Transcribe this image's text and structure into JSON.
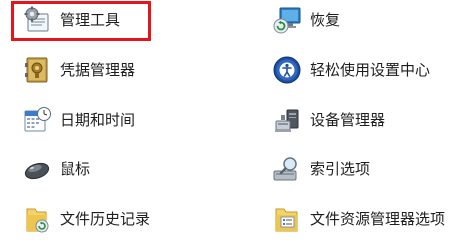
{
  "items": [
    {
      "label": "管理工具",
      "icon": "admin-tools-icon"
    },
    {
      "label": "恢复",
      "icon": "recovery-icon"
    },
    {
      "label": "凭据管理器",
      "icon": "credential-manager-icon"
    },
    {
      "label": "轻松使用设置中心",
      "icon": "ease-of-access-icon"
    },
    {
      "label": "日期和时间",
      "icon": "date-time-icon"
    },
    {
      "label": "设备管理器",
      "icon": "device-manager-icon"
    },
    {
      "label": "鼠标",
      "icon": "mouse-icon"
    },
    {
      "label": "索引选项",
      "icon": "indexing-options-icon"
    },
    {
      "label": "文件历史记录",
      "icon": "file-history-icon"
    },
    {
      "label": "文件资源管理器选项",
      "icon": "file-explorer-options-icon"
    }
  ],
  "highlight_color": "#e8141c"
}
